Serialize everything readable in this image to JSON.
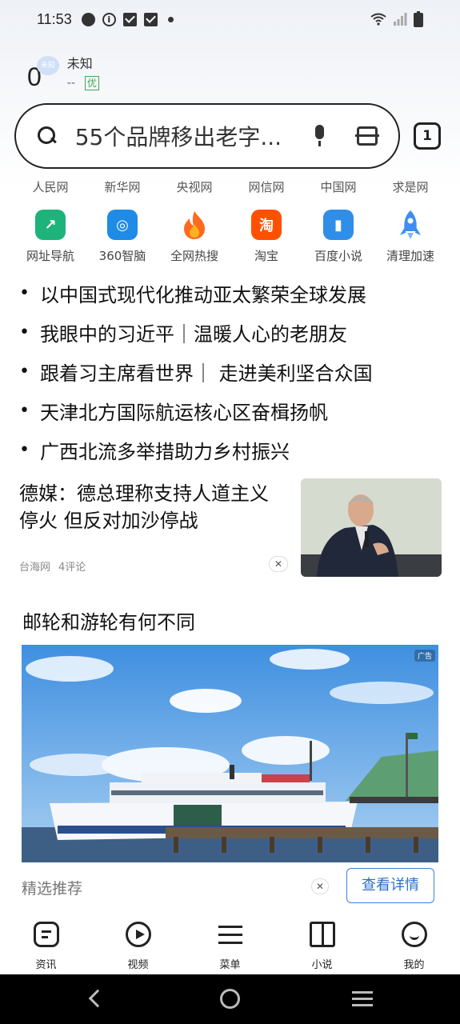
{
  "status_bar": {
    "time": "11:53"
  },
  "weather": {
    "temp": "0",
    "icon_text": "未知",
    "condition": "未知",
    "aq_value": "--",
    "aq_level": "优"
  },
  "search": {
    "query": "55个品牌移出老字...",
    "tab_count": "1"
  },
  "quick_links": [
    "人民网",
    "新华网",
    "央视网",
    "网信网",
    "中国网",
    "求是网"
  ],
  "apps": [
    {
      "label": "网址导航",
      "icon": "compass-icon",
      "glyph": "↗",
      "color": "#1db37a"
    },
    {
      "label": "360智脑",
      "icon": "ai-brain-icon",
      "glyph": "◎",
      "color": "#1e8be6"
    },
    {
      "label": "全网热搜",
      "icon": "flame-icon",
      "glyph": "🔥",
      "color": "#ff6a1f"
    },
    {
      "label": "淘宝",
      "icon": "taobao-icon",
      "glyph": "淘",
      "color": "#ff5000"
    },
    {
      "label": "百度小说",
      "icon": "book-icon",
      "glyph": "▮",
      "color": "#2f8ee8"
    },
    {
      "label": "清理加速",
      "icon": "rocket-icon",
      "glyph": "▲",
      "color": "#3d8ef0"
    }
  ],
  "headlines": [
    "以中国式现代化推动亚太繁荣全球发展",
    "我眼中的习近平｜温暖人心的老朋友",
    "跟着习主席看世界｜ 走进美利坚合众国",
    "天津北方国际航运核心区奋楫扬帆",
    "广西北流多举措助力乡村振兴"
  ],
  "news_card": {
    "title": "德媒：德总理称支持人道主义停火 但反对加沙停战",
    "source": "台海网",
    "comments": "4评论"
  },
  "ad_card": {
    "title": "邮轮和游轮有何不同",
    "badge": "广告",
    "footer_label": "精选推荐",
    "detail_button": "查看详情"
  },
  "bottom_nav": [
    {
      "label": "资讯",
      "icon": "news-icon"
    },
    {
      "label": "视频",
      "icon": "video-icon"
    },
    {
      "label": "菜单",
      "icon": "menu-icon"
    },
    {
      "label": "小说",
      "icon": "book-icon"
    },
    {
      "label": "我的",
      "icon": "profile-icon"
    }
  ]
}
